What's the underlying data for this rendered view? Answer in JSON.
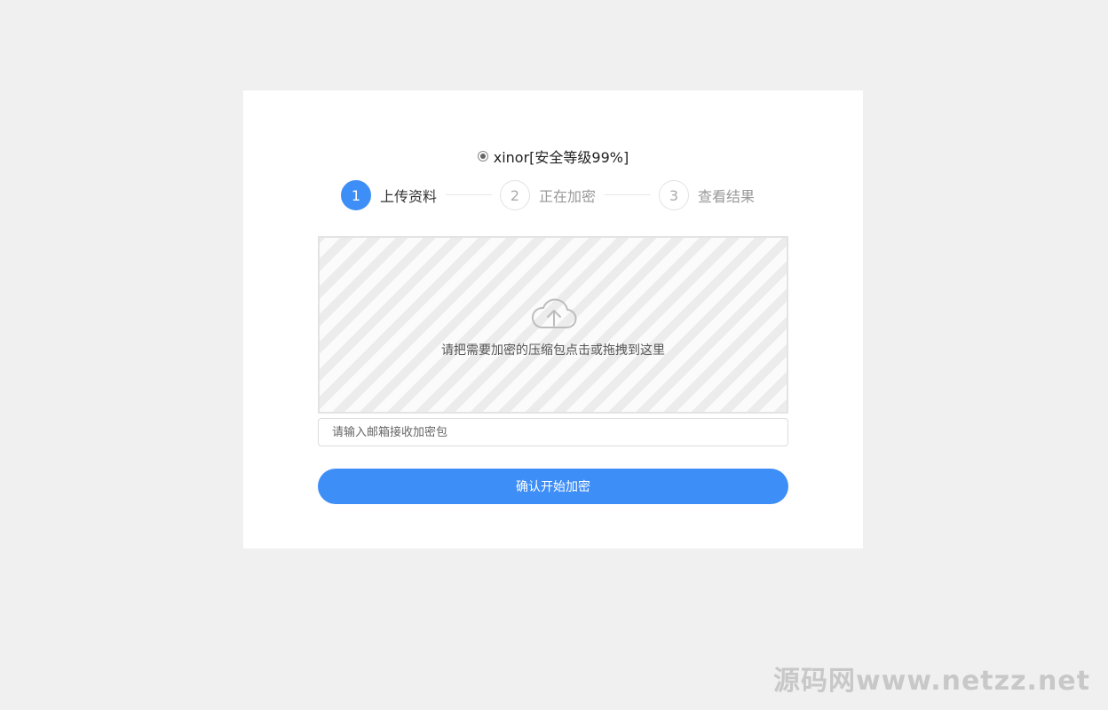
{
  "option": {
    "label": "xinor[安全等级99%]",
    "selected": true
  },
  "steps": [
    {
      "number": "1",
      "label": "上传资料",
      "active": true
    },
    {
      "number": "2",
      "label": "正在加密",
      "active": false
    },
    {
      "number": "3",
      "label": "查看结果",
      "active": false
    }
  ],
  "dropzone": {
    "icon": "cloud-upload-icon",
    "text": "请把需要加密的压缩包点击或拖拽到这里"
  },
  "email": {
    "value": "",
    "placeholder": "请输入邮箱接收加密包"
  },
  "confirm_button": {
    "label": "确认开始加密"
  },
  "watermark": {
    "text": "源码网www.netzz.net"
  },
  "colors": {
    "accent": "#3e8ef7",
    "page_background": "#f0f0f0",
    "card_background": "#ffffff"
  }
}
